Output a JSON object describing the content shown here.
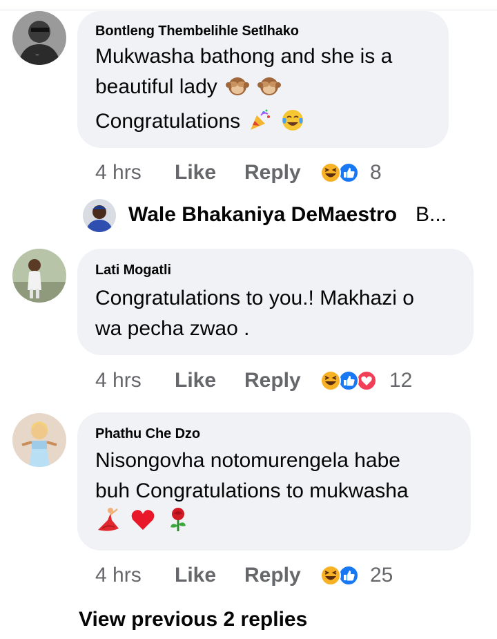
{
  "comments": [
    {
      "author": "Bontleng Thembelihle Setlhako",
      "lines": [
        "Mukwasha bathong and she is a",
        "beautiful lady",
        "Congratulations"
      ],
      "emoji_line2": [
        "see-no-evil-monkey-icon",
        "see-no-evil-monkey-icon"
      ],
      "emoji_line3": [
        "party-popper-icon",
        "tears-of-joy-icon"
      ],
      "time": "4 hrs",
      "like_label": "Like",
      "reply_label": "Reply",
      "reactions": [
        "haha-reaction-icon",
        "like-reaction-icon"
      ],
      "reaction_count": "8"
    },
    {
      "author": "Lati Mogatli",
      "lines": [
        "Congratulations to you.! Makhazi o",
        "wa pecha zwao ."
      ],
      "time": "4 hrs",
      "like_label": "Like",
      "reply_label": "Reply",
      "reactions": [
        "haha-reaction-icon",
        "like-reaction-icon",
        "love-reaction-icon"
      ],
      "reaction_count": "12"
    },
    {
      "author": "Phathu Che Dzo",
      "lines": [
        "Nisongovha notomurengela habe",
        "buh Congratulations to mukwasha"
      ],
      "emoji_line3": [
        "dancer-icon",
        "red-heart-icon",
        "rose-icon"
      ],
      "time": "4 hrs",
      "like_label": "Like",
      "reply_label": "Reply",
      "reactions": [
        "haha-reaction-icon",
        "like-reaction-icon"
      ],
      "reaction_count": "25"
    }
  ],
  "reply_preview": {
    "author": "Wale Bhakaniya DeMaestro",
    "preview": "B..."
  },
  "view_previous_label": "View previous 2 replies",
  "colors": {
    "bubble": "#f0f2f5",
    "meta_text": "#65676b",
    "like_blue": "#1877f2",
    "love_red": "#f33e58",
    "haha_yellow": "#f7b125"
  }
}
